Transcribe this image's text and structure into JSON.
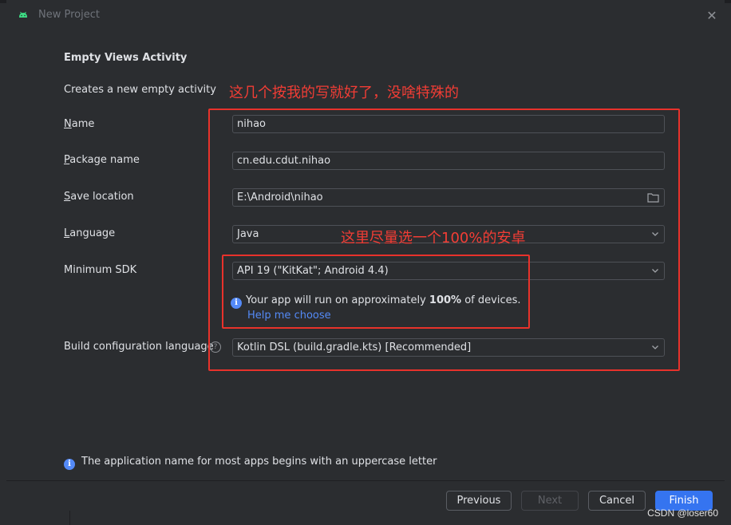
{
  "window": {
    "title": "New Project",
    "icon": "android-icon",
    "close_icon": "close-icon"
  },
  "section": {
    "heading": "Empty Views Activity",
    "description": "Creates a new empty activity"
  },
  "fields": {
    "name": {
      "label_mnemonic": "N",
      "label_rest": "ame",
      "value": "nihao"
    },
    "package": {
      "label_mnemonic": "P",
      "label_rest": "ackage name",
      "value": "cn.edu.cdut.nihao"
    },
    "save_location": {
      "label_mnemonic": "S",
      "label_rest": "ave location",
      "value": "E:\\Android\\nihao",
      "icon": "folder-icon"
    },
    "language": {
      "label_mnemonic": "L",
      "label_rest": "anguage",
      "value": "Java"
    },
    "min_sdk": {
      "label": "Minimum SDK",
      "value": "API 19 (\"KitKat\"; Android 4.4)"
    },
    "build_lang": {
      "label": "Build configuration language",
      "value": "Kotlin DSL (build.gradle.kts) [Recommended]",
      "icon": "question-icon"
    }
  },
  "sdk_info": {
    "prefix": "Your app will run on approximately ",
    "percent": "100%",
    "suffix": " of devices.",
    "help_link": "Help me choose"
  },
  "bottom_info": "The application name for most apps begins with an uppercase letter",
  "buttons": {
    "previous": "Previous",
    "next": "Next",
    "cancel": "Cancel",
    "finish": "Finish"
  },
  "annotations": {
    "top_note": "这几个按我的写就好了，没啥特殊的",
    "sdk_note": "这里尽量选一个100%的安卓"
  },
  "watermark": "CSDN @loser60",
  "colors": {
    "background": "#2b2d30",
    "accent": "#3574f0",
    "link": "#548af7",
    "annotation": "#e8322b"
  }
}
